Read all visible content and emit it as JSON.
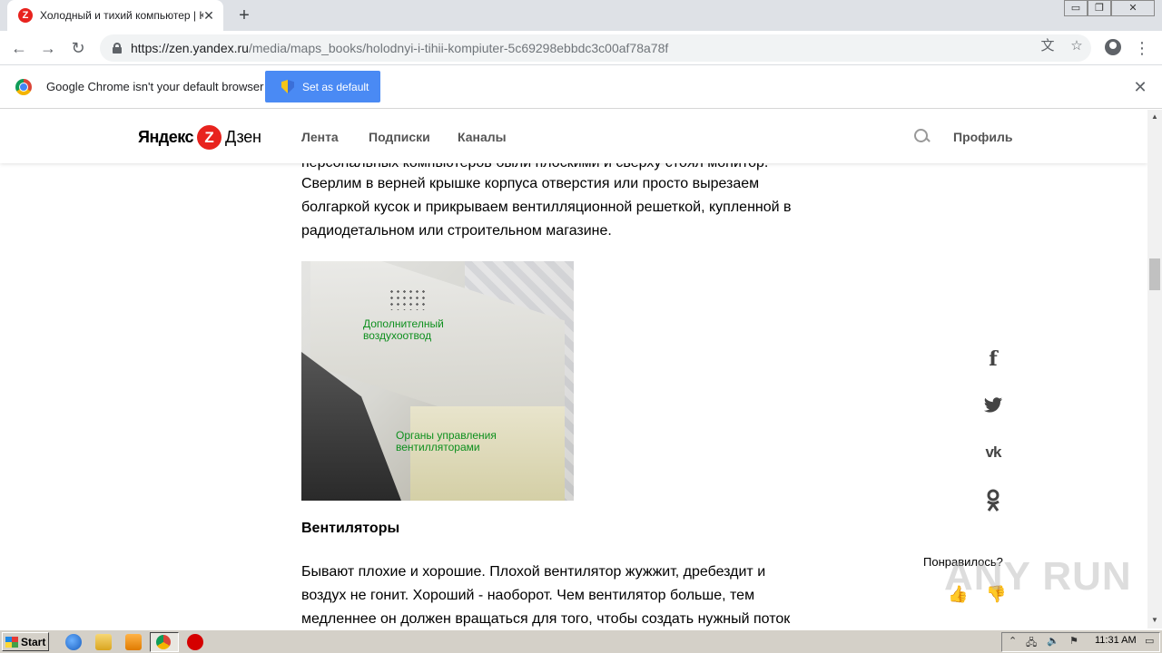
{
  "browser": {
    "tab_title": "Холодный и тихий компьютер | Ка",
    "tab_favicon": "Z",
    "url_host": "https://zen.yandex.ru",
    "url_path": "/media/maps_books/holodnyi-i-tihii-kompiuter-5c69298ebbdc3c00af78a78f",
    "window_controls": [
      "▭",
      "❐",
      "✕"
    ]
  },
  "infobar": {
    "message": "Google Chrome isn't your default browser",
    "button": "Set as default"
  },
  "zen": {
    "logo_left": "Яндекс",
    "logo_mark": "Z",
    "logo_right": "Дзен",
    "nav": [
      "Лента",
      "Подписки",
      "Каналы"
    ],
    "profile": "Профиль"
  },
  "article": {
    "partial_line": "персональных компьютеров были плоскими и сверху стоял монитор.",
    "para1_lines": [
      "Сверлим в верней крышке корпуса отверстия или просто вырезаем",
      "болгаркой кусок и прикрываем вентилляционной решеткой, купленной в",
      "радиодетальном или строительном магазине."
    ],
    "photo_label1": [
      "Дополнителный",
      "воздухоотвод"
    ],
    "photo_label2": [
      "Органы управления",
      "вентилляторами"
    ],
    "heading": "Вентиляторы",
    "para2_lines": [
      "Бывают плохие и хорошие. Плохой вентилятор жужжит, дребездит и",
      "воздух не гонит. Хороший - наоборот. Чем вентилятор больше, тем",
      "медленнее он должен вращаться для того, чтобы создать нужный поток"
    ]
  },
  "share": {
    "icons": [
      "f",
      "t",
      "vk",
      "ok"
    ],
    "liked_question": "Понравилось?"
  },
  "watermark": "ANY RUN",
  "taskbar": {
    "start": "Start",
    "clock": "11:31 AM"
  }
}
